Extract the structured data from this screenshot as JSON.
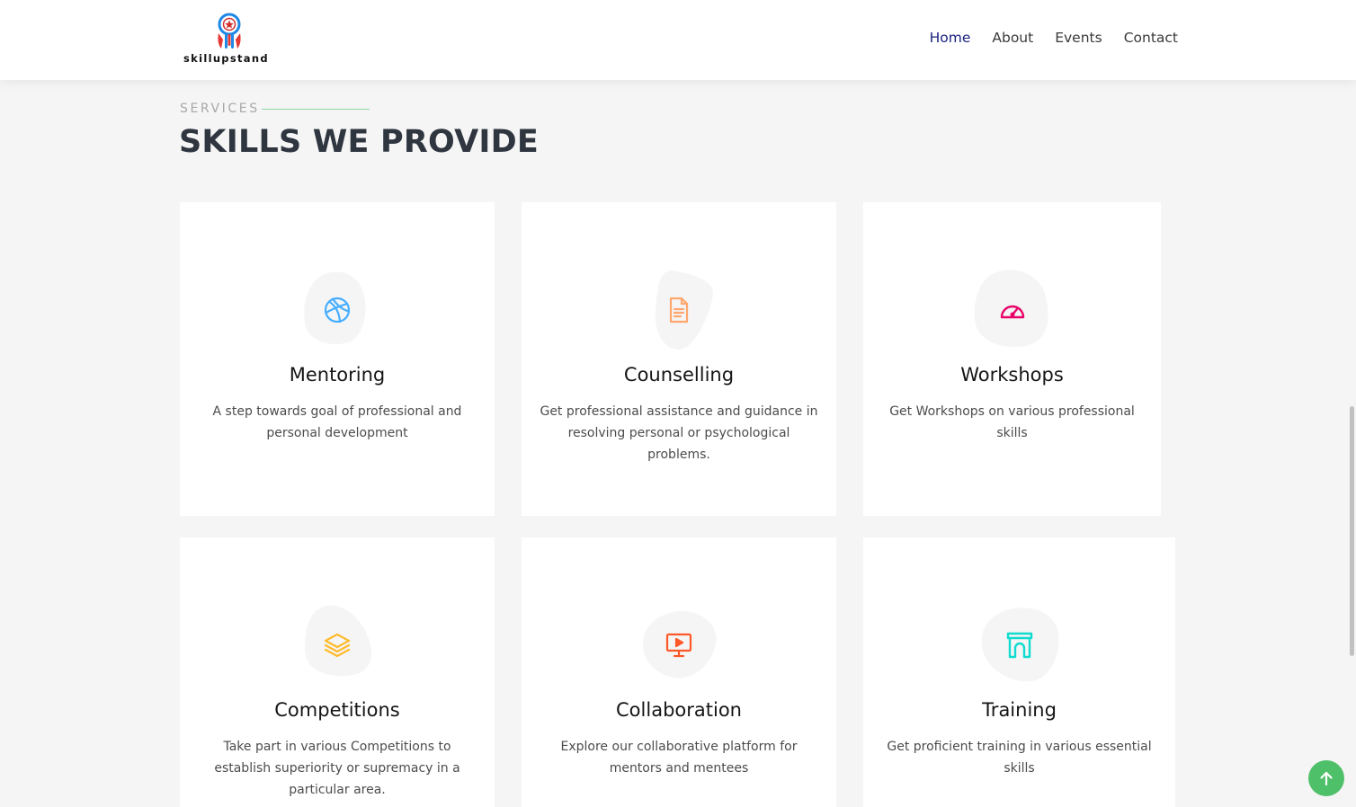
{
  "header": {
    "logo_text": "skillupstand",
    "nav": [
      {
        "label": "Home",
        "active": true
      },
      {
        "label": "About"
      },
      {
        "label": "Events"
      },
      {
        "label": "Contact"
      }
    ]
  },
  "section": {
    "tag": "SERVICES",
    "title": "SKILLS WE PROVIDE"
  },
  "cards": [
    {
      "icon": "basketball-icon",
      "icon_color": "#47aeff",
      "title": "Mentoring",
      "description": "A step towards goal of professional and personal development"
    },
    {
      "icon": "document-icon",
      "icon_color": "#ffa76e",
      "title": "Counselling",
      "description": "Get professional assistance and guidance in resolving personal or psychological problems."
    },
    {
      "icon": "speedometer-icon",
      "icon_color": "#e80368",
      "title": "Workshops",
      "description": "Get Workshops on various professional skills"
    },
    {
      "icon": "layers-icon",
      "icon_color": "#ffbb2c",
      "title": "Competitions",
      "description": "Take part in various Competitions to establish superiority or supremacy in a particular area."
    },
    {
      "icon": "presentation-icon",
      "icon_color": "#ff5828",
      "title": "Collaboration",
      "description": "Explore our collaborative platform for mentors and mentees"
    },
    {
      "icon": "arch-icon",
      "icon_color": "#11dbcf",
      "title": "Training",
      "description": "Get proficient training in various essential skills"
    }
  ],
  "colors": {
    "nav_active": "#1a237e",
    "title": "#2f3640",
    "accent_line": "#8fd7a5",
    "back_to_top": "#4fc06a"
  }
}
